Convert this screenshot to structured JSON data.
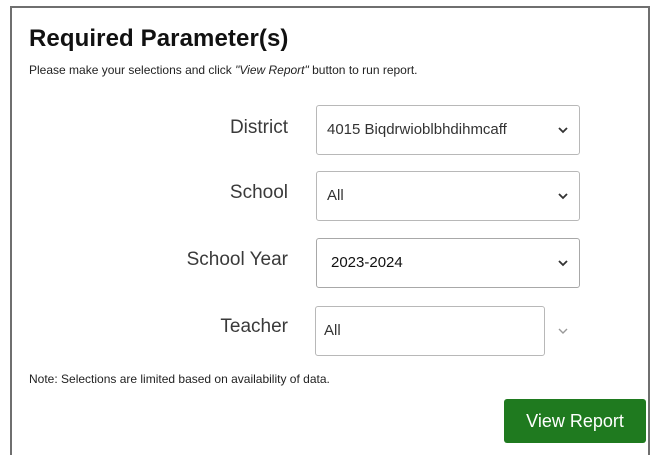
{
  "panel": {
    "title": "Required Parameter(s)",
    "instruction_prefix": "Please make your selections and click ",
    "instruction_emphasis": "\"View Report\"",
    "instruction_suffix": " button to run report."
  },
  "params": {
    "district": {
      "label": "District",
      "value": "4015 Biqdrwioblbhdihmcaff"
    },
    "school": {
      "label": "School",
      "value": "All"
    },
    "school_year": {
      "label": "School Year",
      "value": "2023-2024"
    },
    "teacher": {
      "label": "Teacher",
      "value": "All"
    }
  },
  "note": "Note: Selections are limited based on availability of data.",
  "actions": {
    "view_report_label": "View Report",
    "button_color": "#1f7a1f"
  },
  "icons": {
    "dropdown": "chevron-down-icon"
  }
}
